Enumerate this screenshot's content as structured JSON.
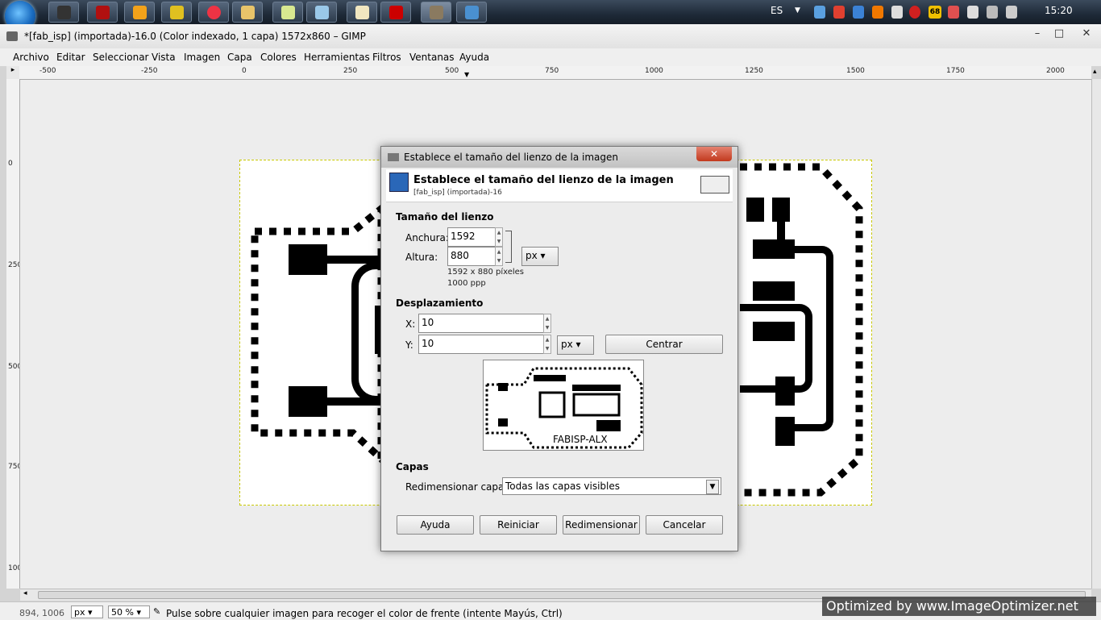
{
  "taskbar": {
    "language": "ES",
    "clock": "15:20",
    "tray_badge": "68",
    "apps": [
      "terminal-app",
      "filezilla-app",
      "media-player-app",
      "notepad-app",
      "chrome-app",
      "explorer-app",
      "folders-app",
      "notepad2-app",
      "paint-app",
      "acrobat-app",
      "gimp-app",
      "window-app"
    ]
  },
  "window": {
    "title": "*[fab_isp] (importada)-16.0 (Color indexado, 1 capa) 1572x860 – GIMP"
  },
  "menu": [
    "Archivo",
    "Editar",
    "Seleccionar",
    "Vista",
    "Imagen",
    "Capa",
    "Colores",
    "Herramientas",
    "Filtros",
    "Ventanas",
    "Ayuda"
  ],
  "ruler_h": [
    "-500",
    "-250",
    "0",
    "250",
    "500",
    "750",
    "1000",
    "1250",
    "1500",
    "1750",
    "2000"
  ],
  "ruler_v": [
    "0",
    "250",
    "500",
    "750",
    "1000"
  ],
  "status": {
    "coords": "894, 1006",
    "unit": "px",
    "zoom": "50 %",
    "message": "Pulse sobre cualquier imagen para recoger el color de frente (intente Mayús, Ctrl)"
  },
  "watermark": "Optimized by www.ImageOptimizer.net",
  "dialog": {
    "title": "Establece el tamaño del lienzo de la imagen",
    "heading": "Establece el tamaño del lienzo de la imagen",
    "subheading": "[fab_isp] (importada)-16",
    "canvas_section": "Tamaño del lienzo",
    "width_label": "Anchura:",
    "width_value": "1592",
    "height_label": "Altura:",
    "height_value": "880",
    "size_unit": "px",
    "size_info": "1592 x 880 píxeles",
    "resolution_info": "1000 ppp",
    "offset_section": "Desplazamiento",
    "x_label": "X:",
    "x_value": "10",
    "y_label": "Y:",
    "y_value": "10",
    "offset_unit": "px",
    "center_button": "Centrar",
    "preview_label": "FABISP-ALX",
    "layers_section": "Capas",
    "resize_layers_label": "Redimensionar capas:",
    "resize_layers_value": "Todas las capas visibles",
    "buttons": {
      "help": "Ayuda",
      "reset": "Reiniciar",
      "resize": "Redimensionar",
      "cancel": "Cancelar"
    }
  }
}
